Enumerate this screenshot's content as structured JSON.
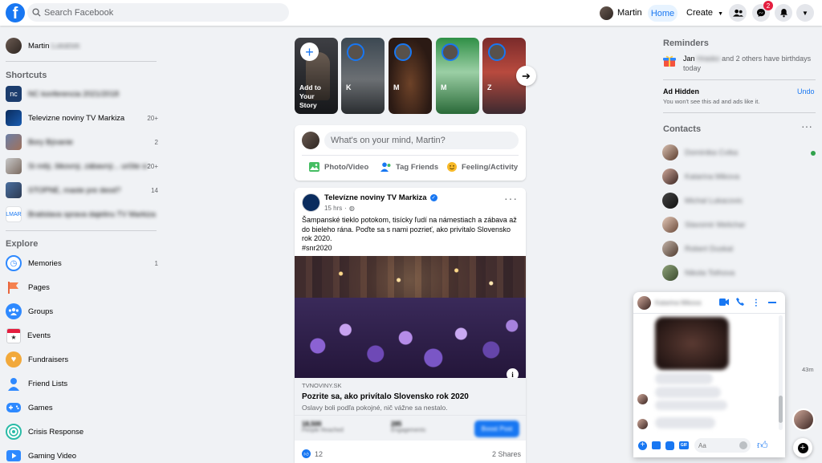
{
  "topbar": {
    "search_placeholder": "Search Facebook",
    "user_name": "Martin",
    "home_label": "Home",
    "create_label": "Create",
    "messenger_badge": "2"
  },
  "left": {
    "user_name": "Martin",
    "shortcuts_header": "Shortcuts",
    "shortcuts": [
      {
        "label": "NC konferencia 2021/2018",
        "count": "",
        "blurred": true
      },
      {
        "label": "Televizne noviny TV Markiza",
        "count": "20+",
        "blurred": false
      },
      {
        "label": "Bory Bývanie",
        "count": "2",
        "blurred": true
      },
      {
        "label": "Si milý, šikovný, zábavný... určite si na Slovakia",
        "count": "20+",
        "blurred": true
      },
      {
        "label": "STOPNE, maste pre deod?",
        "count": "14",
        "blurred": true
      },
      {
        "label": "Bratislava sprava dajelinu TV Markiza",
        "count": "",
        "blurred": true
      }
    ],
    "explore_header": "Explore",
    "explore": [
      {
        "label": "Memories",
        "count": "1"
      },
      {
        "label": "Pages",
        "count": ""
      },
      {
        "label": "Groups",
        "count": ""
      },
      {
        "label": "Events",
        "count": ""
      },
      {
        "label": "Fundraisers",
        "count": ""
      },
      {
        "label": "Friend Lists",
        "count": ""
      },
      {
        "label": "Games",
        "count": ""
      },
      {
        "label": "Crisis Response",
        "count": ""
      },
      {
        "label": "Gaming Video",
        "count": ""
      }
    ]
  },
  "stories": {
    "create_label": "Add to Your Story",
    "items": [
      {
        "name": "K"
      },
      {
        "name": "M"
      },
      {
        "name": "M"
      },
      {
        "name": "Z"
      }
    ]
  },
  "composer": {
    "placeholder": "What's on your mind, Martin?",
    "photo_label": "Photo/Video",
    "tag_label": "Tag Friends",
    "feeling_label": "Feeling/Activity"
  },
  "post": {
    "page_name": "Televízne noviny TV Markiza",
    "time": "15 hrs",
    "text": "Šampanské tieklo potokom, tisícky ľudí na námestiach a zábava až do bieleho rána. Poďte sa s nami pozrieť, ako privítalo Slovensko rok 2020.",
    "hashtag": "#snr2020",
    "link_domain": "TVNOVINY.SK",
    "link_title": "Pozrite sa, ako privítalo Slovensko rok 2020",
    "link_desc": "Oslavy boli podľa pokojné, nič vážne sa nestalo.",
    "stat1_value": "18,500",
    "stat1_label": "People Reached",
    "stat2_value": "285",
    "stat2_label": "Engagements",
    "watch_label": "Boost Post",
    "likes": "12",
    "shares": "2 Shares"
  },
  "right": {
    "reminders_header": "Reminders",
    "reminder_prefix": "Jan",
    "reminder_blur": "Hrasko",
    "reminder_text": "and 2 others have birthdays today",
    "ad_hidden_title": "Ad Hidden",
    "ad_hidden_undo": "Undo",
    "ad_hidden_text": "You won't see this ad and ads like it.",
    "contacts_header": "Contacts",
    "contacts": [
      {
        "name": "Dominika Cvika",
        "online": true
      },
      {
        "name": "Katarina Mikova",
        "online": false
      },
      {
        "name": "Michal Lukacovic",
        "online": false
      },
      {
        "name": "Slavomir Melichar",
        "online": false
      },
      {
        "name": "Robert Duskal",
        "online": false
      },
      {
        "name": "Nikola Tothova",
        "online": false
      }
    ],
    "time_label": "43m"
  },
  "chat": {
    "name": "Katarina Mikova",
    "input_placeholder": "Aa"
  },
  "colors": {
    "accent": "#1877f2",
    "badge": "#e41e3f",
    "online": "#31a24c"
  }
}
